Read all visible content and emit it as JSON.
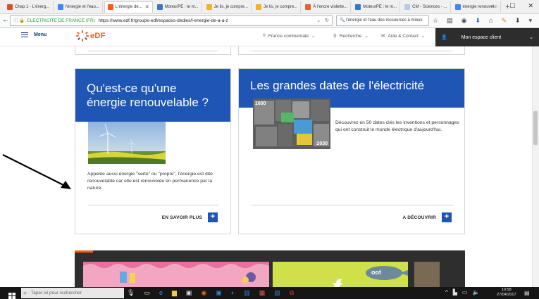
{
  "browser": {
    "tabs": [
      {
        "label": "Chap 1 - L'énerg...",
        "color": "#d9502f"
      },
      {
        "label": "l'énergie et l'eau...",
        "color": "#4285f4"
      },
      {
        "label": "L'énergie de...",
        "color": "#fe5815",
        "active": true
      },
      {
        "label": "MoteurPE : le m...",
        "color": "#3a76c8"
      },
      {
        "label": "Je lis, je compre...",
        "color": "#f3b12b"
      },
      {
        "label": "Je lis, je compre...",
        "color": "#f3b12b"
      },
      {
        "label": "À l'encre violette...",
        "color": "#e0622d"
      },
      {
        "label": "MoteurPE : le m...",
        "color": "#3a76c8"
      },
      {
        "label": "CM - Sciences - ...",
        "color": "#b9c8e8"
      },
      {
        "label": "énergie renouvel...",
        "color": "#4285f4"
      }
    ],
    "window_controls": [
      "—",
      "☐",
      "✕"
    ],
    "identity": "ELECTRICITE DE FRANCE (FR)",
    "url": "https://www.edf.fr/groupe-edf/espaces-dedies/l-energie-de-a-a-z",
    "search_text": "l'énergie et l'eau des ressources à mieux"
  },
  "site": {
    "menu_label": "Menu",
    "logo_text": "eDF",
    "nav": {
      "region": "France continentale",
      "search": "Recherche",
      "help": "Aide & Contact",
      "account": "Mon espace client"
    }
  },
  "cards": [
    {
      "title": "Qu'est-ce qu'une énergie renouvelable ?",
      "text": "Appelée aussi énergie \"verte\" ou \"propre\", l'énergie est dite renouvelable car elle est renouvelée en permanence par la nature.",
      "cta": "EN SAVOIR PLUS"
    },
    {
      "title": "Les grandes dates de l'électricité",
      "text": "Découvrez en 50 dates clés les inventions et personnages qui ont construit le monde électrique d'aujourd'hui.",
      "cta": "A DÉCOUVRIR",
      "year_start": "1600",
      "year_end": "2030"
    }
  ],
  "banner": {
    "rocket_text": "oot"
  },
  "taskbar": {
    "search_placeholder": "Taper ici pour rechercher",
    "time": "10:58",
    "date": "27/04/2017"
  },
  "colors": {
    "edf_blue": "#1f55b4",
    "edf_orange": "#fe5815",
    "dark_header": "#2d2d2d"
  }
}
